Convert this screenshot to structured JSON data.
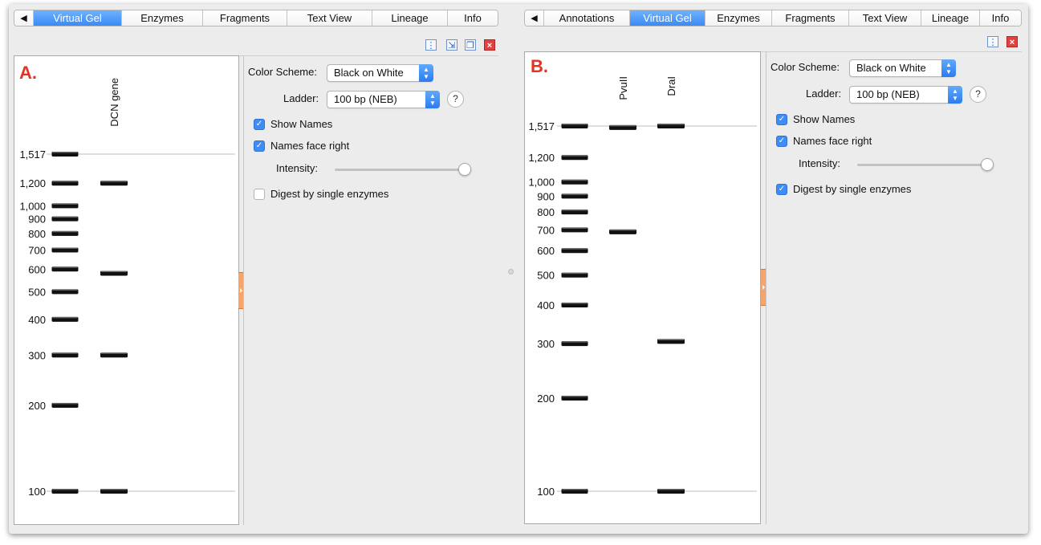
{
  "panels": [
    {
      "id": "A",
      "tabs": [
        {
          "label": "◀",
          "active": false,
          "kind": "arrow"
        },
        {
          "label": "Virtual Gel",
          "active": true
        },
        {
          "label": "Enzymes",
          "active": false
        },
        {
          "label": "Fragments",
          "active": false
        },
        {
          "label": "Text View",
          "active": false
        },
        {
          "label": "Lineage",
          "active": false
        },
        {
          "label": "Info",
          "active": false
        }
      ],
      "toolbar_icons": [
        "column-chooser-icon",
        "shrink-icon",
        "pop-out-icon",
        "close-icon"
      ],
      "gel": {
        "panel_label": "A.",
        "lanes": [
          {
            "name": "DCN gene",
            "bands": [
              1200,
              580,
              300,
              100
            ]
          }
        ]
      },
      "settings": {
        "color_scheme_label": "Color Scheme:",
        "color_scheme_value": "Black on White",
        "ladder_label": "Ladder:",
        "ladder_value": "100 bp (NEB)",
        "help_label": "?",
        "show_names_label": "Show Names",
        "show_names_checked": true,
        "names_face_right_label": "Names face right",
        "names_face_right_checked": true,
        "intensity_label": "Intensity:",
        "intensity_value": 1.0,
        "digest_label": "Digest by single enzymes",
        "digest_checked": false
      }
    },
    {
      "id": "B",
      "tabs": [
        {
          "label": "◀",
          "active": false,
          "kind": "arrow"
        },
        {
          "label": "Annotations",
          "active": false
        },
        {
          "label": "Virtual Gel",
          "active": true
        },
        {
          "label": "Enzymes",
          "active": false
        },
        {
          "label": "Fragments",
          "active": false
        },
        {
          "label": "Text View",
          "active": false
        },
        {
          "label": "Lineage",
          "active": false
        },
        {
          "label": "Info",
          "active": false
        }
      ],
      "toolbar_icons": [
        "column-chooser-icon",
        "close-icon"
      ],
      "gel": {
        "panel_label": "B.",
        "lanes": [
          {
            "name": "PvuII",
            "bands": [
              1500,
              690
            ]
          },
          {
            "name": "DraI",
            "bands": [
              1517,
              305,
              100
            ]
          }
        ]
      },
      "settings": {
        "color_scheme_label": "Color Scheme:",
        "color_scheme_value": "Black on White",
        "ladder_label": "Ladder:",
        "ladder_value": "100 bp (NEB)",
        "help_label": "?",
        "show_names_label": "Show Names",
        "show_names_checked": true,
        "names_face_right_label": "Names face right",
        "names_face_right_checked": true,
        "intensity_label": "Intensity:",
        "intensity_value": 1.0,
        "digest_label": "Digest by single enzymes",
        "digest_checked": true
      }
    }
  ],
  "ladder": {
    "name": "100 bp (NEB)",
    "sizes": [
      1517,
      1200,
      1000,
      900,
      800,
      700,
      600,
      500,
      400,
      300,
      200,
      100
    ],
    "labels": [
      "1,517",
      "1,200",
      "1,000",
      "900",
      "800",
      "700",
      "600",
      "500",
      "400",
      "300",
      "200",
      "100"
    ],
    "reference_lines": [
      1517,
      100
    ]
  },
  "colors": {
    "accent": "#3a8af7",
    "panel_label": "#e8311f",
    "band": "#111111",
    "handle": "#f5a56b"
  }
}
